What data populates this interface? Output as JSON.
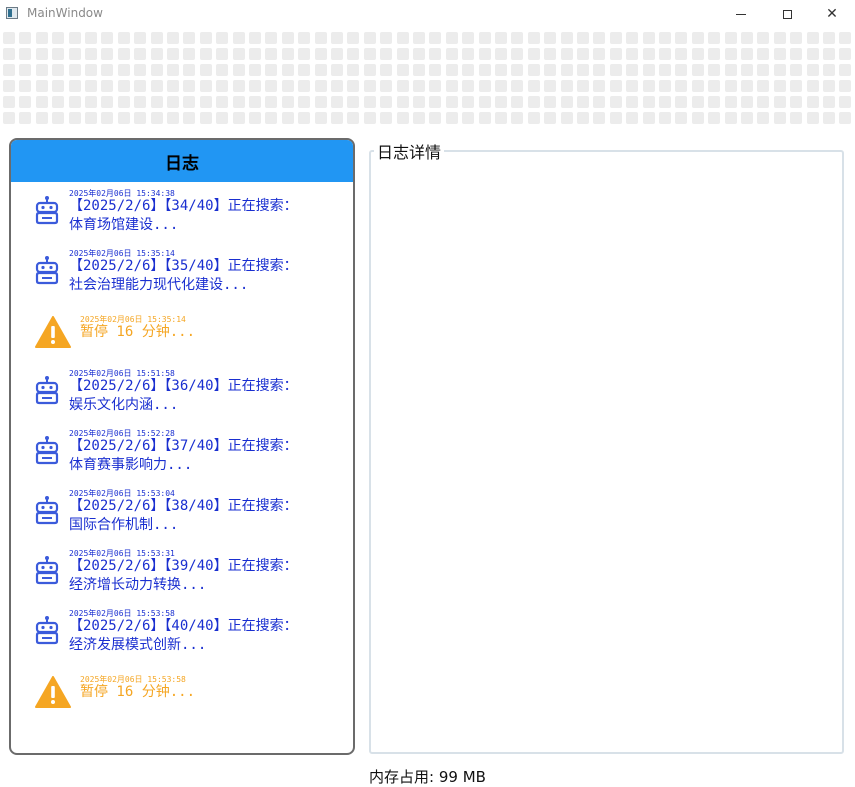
{
  "window": {
    "title": "MainWindow"
  },
  "log_panel": {
    "header": "日志",
    "entries": [
      {
        "type": "robot",
        "timestamp": "2025年02月06日 15:34:38",
        "line1": "【2025/2/6】【34/40】正在搜索：",
        "line2": "体育场馆建设..."
      },
      {
        "type": "robot",
        "timestamp": "2025年02月06日 15:35:14",
        "line1": "【2025/2/6】【35/40】正在搜索：",
        "line2": "社会治理能力现代化建设..."
      },
      {
        "type": "warning",
        "timestamp": "2025年02月06日 15:35:14",
        "line1": "暂停 16 分钟..."
      },
      {
        "type": "robot",
        "timestamp": "2025年02月06日 15:51:58",
        "line1": "【2025/2/6】【36/40】正在搜索：",
        "line2": "娱乐文化内涵..."
      },
      {
        "type": "robot",
        "timestamp": "2025年02月06日 15:52:28",
        "line1": "【2025/2/6】【37/40】正在搜索：",
        "line2": "体育赛事影响力..."
      },
      {
        "type": "robot",
        "timestamp": "2025年02月06日 15:53:04",
        "line1": "【2025/2/6】【38/40】正在搜索：",
        "line2": "国际合作机制..."
      },
      {
        "type": "robot",
        "timestamp": "2025年02月06日 15:53:31",
        "line1": "【2025/2/6】【39/40】正在搜索：",
        "line2": "经济增长动力转换..."
      },
      {
        "type": "robot",
        "timestamp": "2025年02月06日 15:53:58",
        "line1": "【2025/2/6】【40/40】正在搜索：",
        "line2": "经济发展模式创新..."
      },
      {
        "type": "warning",
        "timestamp": "2025年02月06日 15:53:58",
        "line1": "暂停 16 分钟..."
      }
    ]
  },
  "detail_panel": {
    "title": "日志详情"
  },
  "status": {
    "memory": "内存占用: 99 MB"
  },
  "colors": {
    "header_blue": "#2196f3",
    "log_blue": "#1a2fd0",
    "warning_orange": "#f5a623",
    "robot_icon": "#3b5bdb"
  },
  "icons": {
    "robot": "robot-icon",
    "warning": "warning-icon"
  }
}
